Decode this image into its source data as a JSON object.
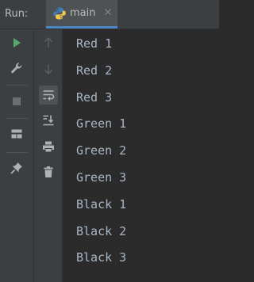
{
  "header": {
    "run_label": "Run:",
    "tab": {
      "label": "main",
      "icon": "python-icon",
      "close_icon": "close-icon"
    }
  },
  "toolbar_left": [
    {
      "name": "rerun-icon",
      "color": "#59a869"
    },
    {
      "name": "wrench-icon",
      "color": "#afb1b3"
    },
    {
      "name": "stop-icon",
      "color": "#6e6e6e"
    },
    {
      "name": "layout-icon",
      "color": "#afb1b3"
    },
    {
      "name": "pin-icon",
      "color": "#afb1b3"
    }
  ],
  "toolbar_right": [
    {
      "name": "up-arrow-icon",
      "color": "#5a5d5f"
    },
    {
      "name": "down-arrow-icon",
      "color": "#5a5d5f"
    },
    {
      "name": "soft-wrap-icon",
      "color": "#afb1b3",
      "active": true
    },
    {
      "name": "scroll-to-end-icon",
      "color": "#afb1b3"
    },
    {
      "name": "print-icon",
      "color": "#afb1b3"
    },
    {
      "name": "trash-icon",
      "color": "#afb1b3"
    }
  ],
  "console": {
    "lines": [
      "Red 1",
      "Red 2",
      "Red 3",
      "Green 1",
      "Green 2",
      "Green 3",
      "Black 1",
      "Black 2",
      "Black 3"
    ]
  },
  "colors": {
    "background": "#2b2b2b",
    "panel": "#3c3f41",
    "text": "#a9b7c6",
    "accent": "#4a88c7"
  }
}
